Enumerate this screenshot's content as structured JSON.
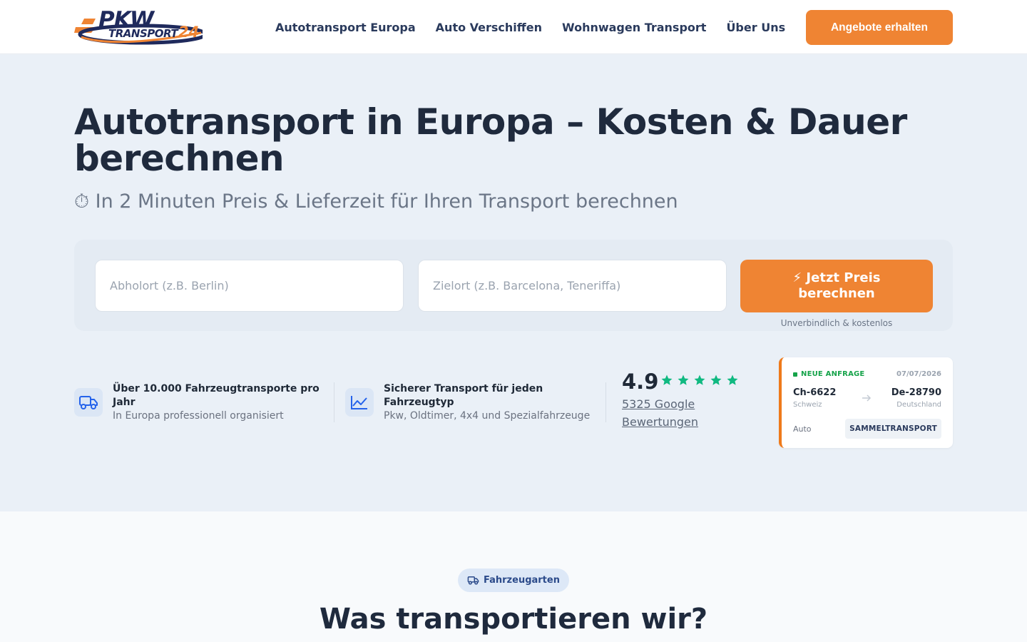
{
  "brand": {
    "logo_top": "PKW",
    "logo_bottom": "TRANSPORT",
    "logo_number": "24",
    "primary_color": "#ef8433",
    "navy_color": "#1f2a5c"
  },
  "nav": {
    "items": [
      {
        "label": "Autotransport Europa"
      },
      {
        "label": "Auto Verschiffen"
      },
      {
        "label": "Wohnwagen Transport"
      },
      {
        "label": "Über Uns"
      }
    ],
    "cta_label": "Angebote erhalten"
  },
  "hero": {
    "title": "Autotransport in Europa – Kosten & Dauer berechnen",
    "subtitle": "⏱ In 2 Minuten Preis & Lieferzeit für Ihren Transport berechnen",
    "form": {
      "from_placeholder": "Abholort (z.B. Berlin)",
      "to_placeholder": "Zielort (z.B. Barcelona, Teneriffa)",
      "submit_label": "⚡ Jetzt Preis berechnen",
      "submit_note": "Unverbindlich & kostenlos"
    }
  },
  "features": [
    {
      "icon": "truck-icon",
      "title": "Über 10.000 Fahrzeugtransporte pro Jahr",
      "desc": "In Europa professionell organisiert"
    },
    {
      "icon": "chart-icon",
      "title": "Sicherer Transport für jeden Fahrzeugtyp",
      "desc": "Pkw, Oldtimer, 4x4 und Spezialfahrzeuge"
    }
  ],
  "rating": {
    "score": "4.9",
    "stars": 5,
    "reviews_label": "5325 Google Bewertungen",
    "star_color": "#10b981"
  },
  "request_card": {
    "badge": "NEUE ANFRAGE",
    "date": "07/07/2026",
    "from_code": "Ch-6622",
    "from_country": "Schweiz",
    "to_code": "De-28790",
    "to_country": "Deutschland",
    "vehicle": "Auto",
    "tag": "SAMMELTRANSPORT"
  },
  "section": {
    "pill_label": "Fahrzeugarten",
    "title": "Was transportieren wir?"
  }
}
